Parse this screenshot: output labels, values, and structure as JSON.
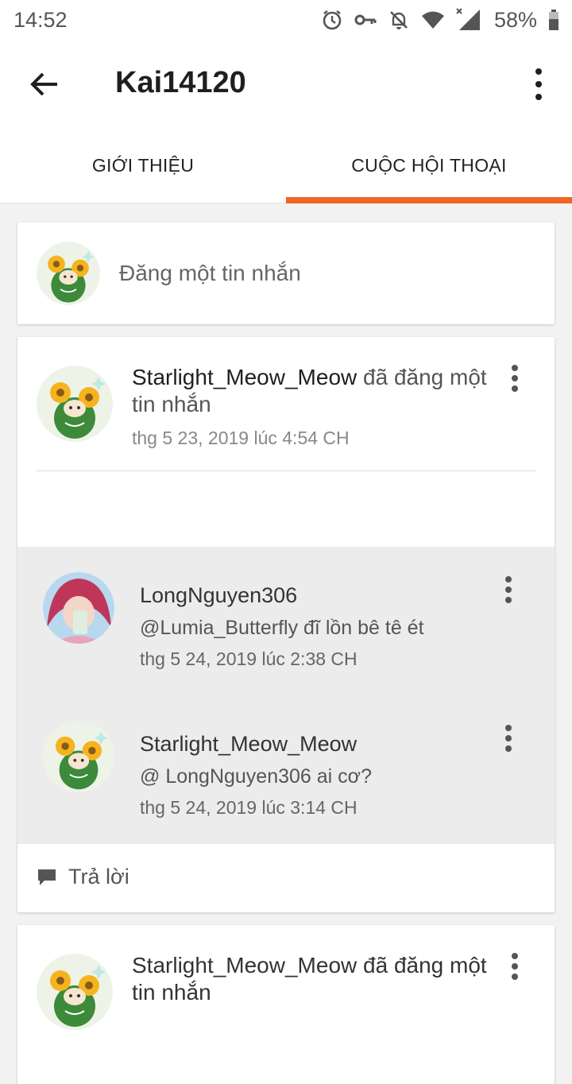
{
  "status_bar": {
    "time": "14:52",
    "battery": "58%",
    "icons": [
      "alarm-icon",
      "key-icon",
      "notifications-off-icon",
      "wifi-icon",
      "signal-icon",
      "battery-icon"
    ]
  },
  "app_bar": {
    "title": "Kai14120",
    "back_icon": "arrow-back-icon",
    "more_icon": "more-vert-icon"
  },
  "tabs": [
    {
      "label": "GIỚI THIỆU",
      "selected": false
    },
    {
      "label": "CUỘC HỘI THOẠI",
      "selected": true
    }
  ],
  "accent_color": "#f26522",
  "post_box": {
    "placeholder": "Đăng một tin nhắn"
  },
  "threads": [
    {
      "user": "Starlight_Meow_Meow",
      "action": "đã đăng một tin nhắn",
      "timestamp": "thg 5 23, 2019 lúc 4:54 CH",
      "replies": [
        {
          "user": "LongNguyen306",
          "text": "@Lumia_Butterfly đĩ lồn bê tê ét",
          "timestamp": "thg 5 24, 2019 lúc 2:38 CH"
        },
        {
          "user": "Starlight_Meow_Meow",
          "text": "@ LongNguyen306  ai cơ?",
          "timestamp": "thg 5 24, 2019 lúc 3:14 CH"
        }
      ],
      "reply_label": "Trả lời"
    },
    {
      "user": "Starlight_Meow_Meow",
      "action": "đã đăng một tin nhắn"
    }
  ]
}
